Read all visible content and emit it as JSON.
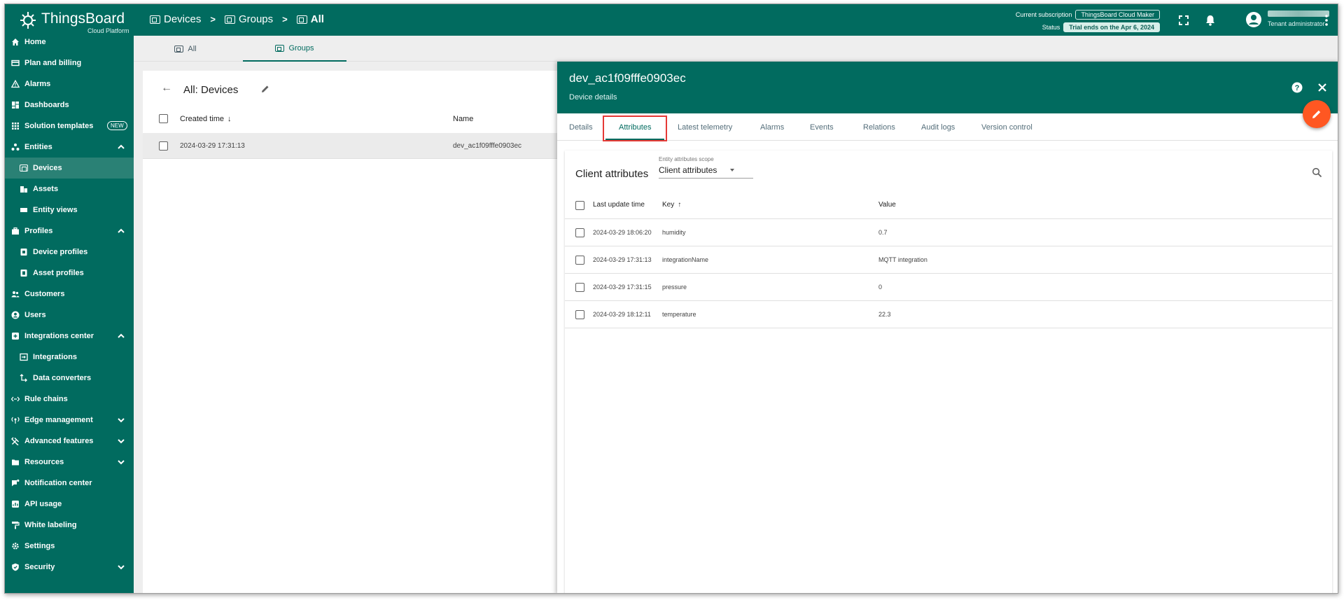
{
  "header": {
    "logo_name": "ThingsBoard",
    "logo_sub": "Cloud Platform",
    "breadcrumbs": [
      {
        "label": "Devices"
      },
      {
        "label": "Groups"
      },
      {
        "label": "All"
      }
    ],
    "breadcrumb_sep": ">",
    "subscription_label": "Current subscription",
    "subscription_value": "ThingsBoard Cloud Maker",
    "status_label": "Status",
    "status_value": "Trial ends on the Apr 6, 2024",
    "user_role": "Tenant administrator"
  },
  "sidebar": {
    "items": [
      {
        "label": "Home",
        "icon": "home-icon"
      },
      {
        "label": "Plan and billing",
        "icon": "billing-icon"
      },
      {
        "label": "Alarms",
        "icon": "alarm-icon"
      },
      {
        "label": "Dashboards",
        "icon": "dashboard-icon"
      },
      {
        "label": "Solution templates",
        "icon": "grid-icon",
        "badge": "NEW"
      },
      {
        "label": "Entities",
        "icon": "entities-icon"
      },
      {
        "label": "Devices",
        "icon": "device-icon"
      },
      {
        "label": "Assets",
        "icon": "asset-icon"
      },
      {
        "label": "Entity views",
        "icon": "entity-view-icon"
      },
      {
        "label": "Profiles",
        "icon": "profiles-icon"
      },
      {
        "label": "Device profiles",
        "icon": "device-profile-icon"
      },
      {
        "label": "Asset profiles",
        "icon": "asset-profile-icon"
      },
      {
        "label": "Customers",
        "icon": "customers-icon"
      },
      {
        "label": "Users",
        "icon": "user-icon"
      },
      {
        "label": "Integrations center",
        "icon": "integrations-center-icon"
      },
      {
        "label": "Integrations",
        "icon": "integration-icon"
      },
      {
        "label": "Data converters",
        "icon": "converter-icon"
      },
      {
        "label": "Rule chains",
        "icon": "rule-chain-icon"
      },
      {
        "label": "Edge management",
        "icon": "edge-icon"
      },
      {
        "label": "Advanced features",
        "icon": "tools-icon"
      },
      {
        "label": "Resources",
        "icon": "folder-icon"
      },
      {
        "label": "Notification center",
        "icon": "notification-icon"
      },
      {
        "label": "API usage",
        "icon": "api-icon"
      },
      {
        "label": "White labeling",
        "icon": "paint-roller-icon"
      },
      {
        "label": "Settings",
        "icon": "settings-icon"
      },
      {
        "label": "Security",
        "icon": "shield-icon"
      }
    ]
  },
  "top_tabs": [
    {
      "label": "All"
    },
    {
      "label": "Groups"
    }
  ],
  "device_list": {
    "title": "All: Devices",
    "columns": [
      "Created time",
      "Name"
    ],
    "rows": [
      {
        "created": "2024-03-29 17:31:13",
        "name": "dev_ac1f09fffe0903ec"
      }
    ]
  },
  "detail": {
    "title": "dev_ac1f09fffe0903ec",
    "subtitle": "Device details",
    "tabs": [
      "Details",
      "Attributes",
      "Latest telemetry",
      "Alarms",
      "Events",
      "Relations",
      "Audit logs",
      "Version control"
    ],
    "attributes": {
      "title": "Client attributes",
      "scope_label": "Entity attributes scope",
      "scope_value": "Client attributes",
      "columns": [
        "Last update time",
        "Key",
        "Value"
      ],
      "rows": [
        {
          "time": "2024-03-29 18:06:20",
          "key": "humidity",
          "value": "0.7"
        },
        {
          "time": "2024-03-29 17:31:13",
          "key": "integrationName",
          "value": "MQTT integration"
        },
        {
          "time": "2024-03-29 17:31:15",
          "key": "pressure",
          "value": "0"
        },
        {
          "time": "2024-03-29 18:12:11",
          "key": "temperature",
          "value": "22.3"
        }
      ]
    }
  },
  "colors": {
    "brand": "#016b5f",
    "accent_fab": "#ff5722",
    "highlight_box": "#e53935"
  }
}
